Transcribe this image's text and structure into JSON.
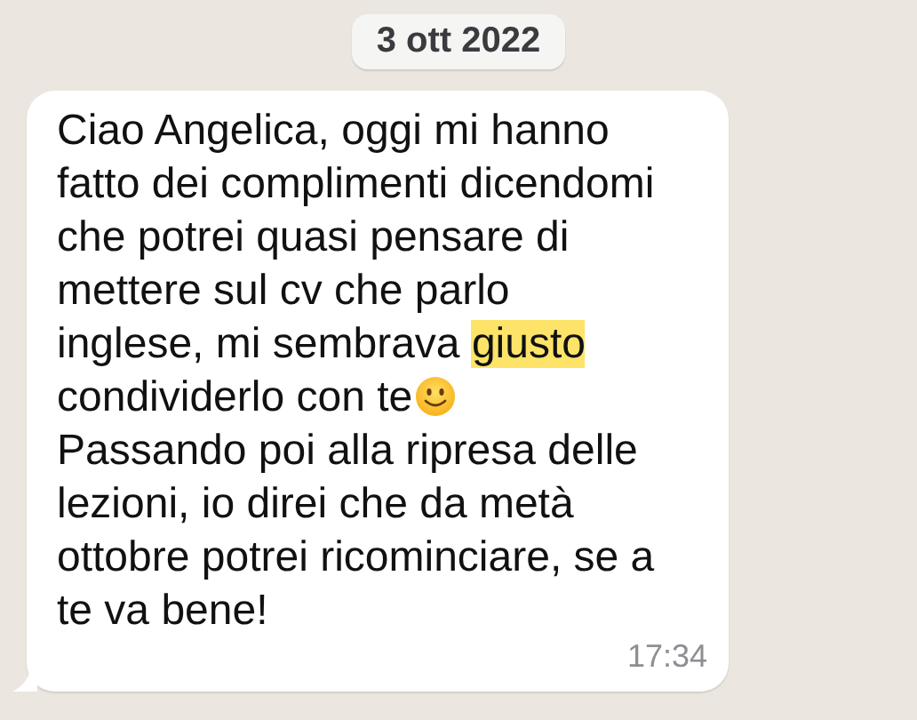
{
  "date_separator": "3 ott 2022",
  "message": {
    "before": "Ciao Angelica, oggi mi hanno fatto dei complimenti dicendomi che potrei quasi pensare di mettere sul cv che parlo inglese, mi sembrava ",
    "highlight": "giusto",
    "after": " condividerlo con te",
    "continuation": "Passando poi alla ripresa delle lezioni, io direi che da metà ottobre potrei ricominciare, se a te va bene!",
    "time": "17:34"
  }
}
